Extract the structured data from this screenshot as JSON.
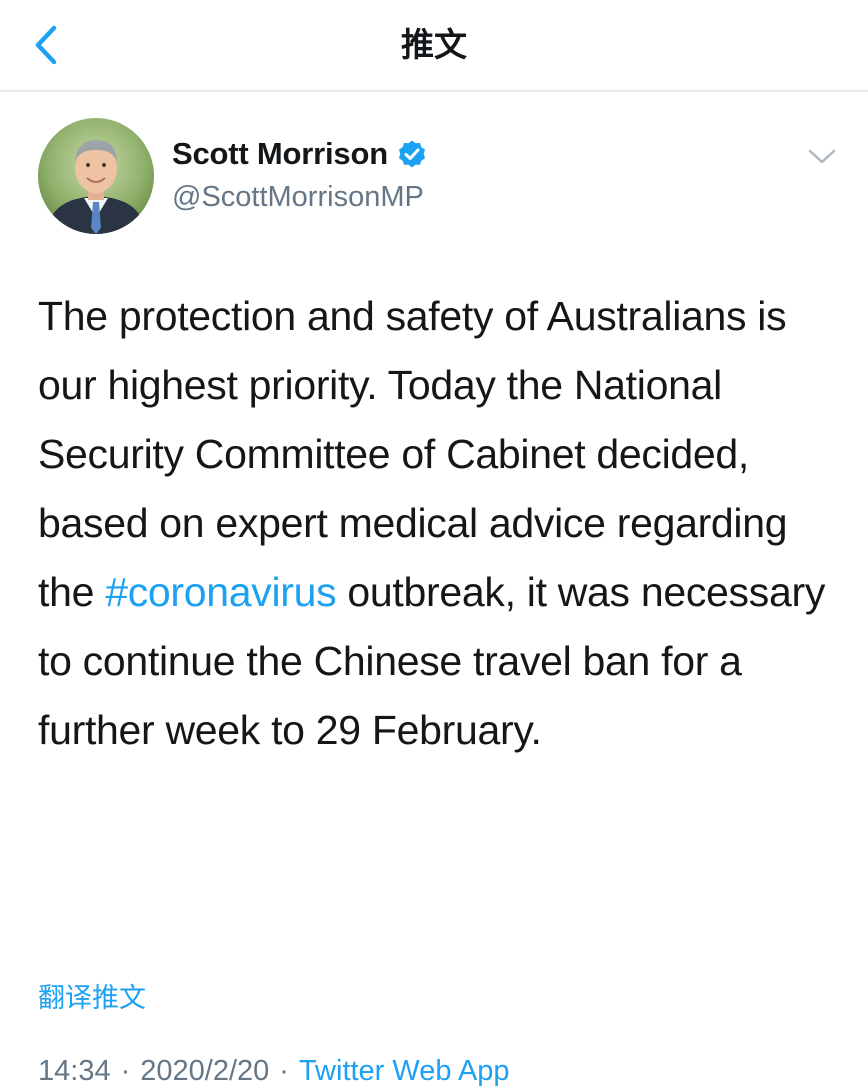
{
  "header": {
    "title": "推文",
    "back_icon": "chevron-left-icon"
  },
  "tweet": {
    "author_name": "Scott Morrison",
    "author_handle": "@ScottMorrisonMP",
    "verified": true,
    "text_before": "The protection and safety of Australians is our highest priority. Today the National Security Committee of Cabinet decided, based on expert medical advice regarding the ",
    "hashtag": "#coronavirus",
    "text_after": " outbreak, it was necessary to continue the Chinese travel ban for a further week to 29 February.",
    "translate_label": "翻译推文",
    "time": "14:34",
    "date": "2020/2/20",
    "separator": "·",
    "source": "Twitter Web App"
  },
  "colors": {
    "accent": "#1da1f2",
    "secondary_text": "#657786",
    "primary_text": "#14171a"
  }
}
